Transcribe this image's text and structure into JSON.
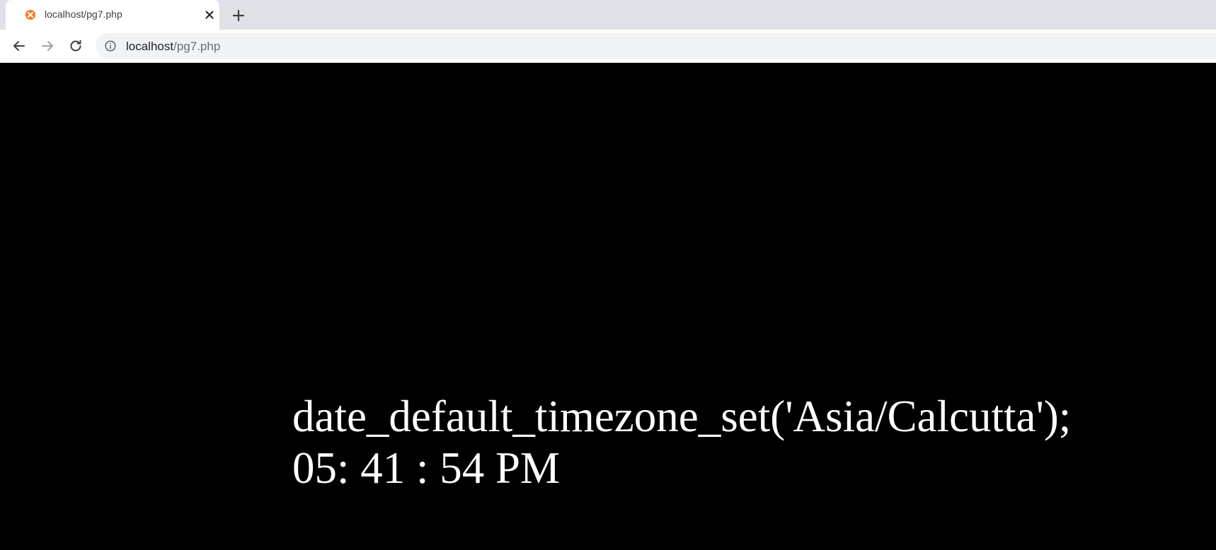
{
  "browser": {
    "tab": {
      "title": "localhost/pg7.php",
      "favicon": "xampp-icon"
    },
    "new_tab_icon": "plus-icon",
    "nav": {
      "back_icon": "arrow-left-icon",
      "forward_icon": "arrow-right-icon",
      "reload_icon": "reload-icon"
    },
    "address_bar": {
      "info_icon": "info-icon",
      "host": "localhost",
      "path": "/pg7.php"
    }
  },
  "page": {
    "code_text": "date_default_timezone_set('Asia/Calcutta');",
    "time_text": "05: 41 : 54 PM",
    "background": "#000000",
    "text_color": "#ffffff"
  }
}
